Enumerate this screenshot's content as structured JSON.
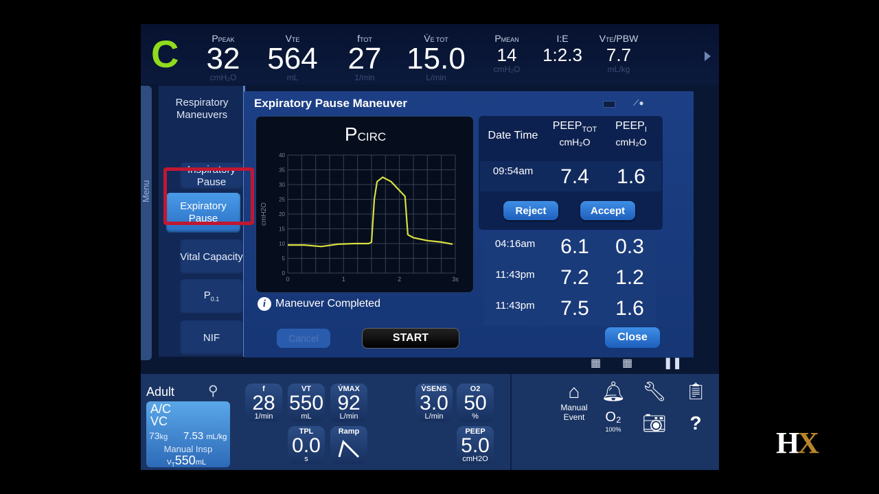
{
  "top": {
    "mode_letter": "C",
    "vitals": [
      {
        "label_main": "P",
        "label_sub": "PEAK",
        "value": "32",
        "unit": "cmH₂O",
        "x": 90,
        "w": 60
      },
      {
        "label_main": "V",
        "label_sub": "TE",
        "value": "564",
        "unit": "mL",
        "x": 180,
        "w": 82
      },
      {
        "label_main": "f",
        "label_sub": "TOT",
        "value": "27",
        "unit": "1/min",
        "x": 298,
        "w": 56
      },
      {
        "label_main": "V̇",
        "label_sub": "E TOT",
        "value": "15.0",
        "unit": "L/min",
        "x": 382,
        "w": 96
      },
      {
        "label_main": "P",
        "label_sub": "MEAN",
        "value": "14",
        "unit": "cmH₂O",
        "x": 506,
        "w": 54
      },
      {
        "label_main": "I:E",
        "label_sub": "",
        "value": "1:2.3",
        "unit": "",
        "x": 584,
        "w": 60
      },
      {
        "label_main": "V",
        "label_sub": "TE",
        "label_extra": "/PBW",
        "value": "7.7",
        "unit": "mL/kg",
        "x": 658,
        "w": 76
      }
    ]
  },
  "menu_label": "Menu",
  "maneuvers": {
    "title": "Respiratory Maneuvers",
    "items": [
      {
        "label": "Inspiratory Pause",
        "selected": false
      },
      {
        "label": "Expiratory Pause",
        "selected": true
      },
      {
        "label": "Vital Capacity",
        "selected": false
      },
      {
        "label": "P0.1",
        "selected": false
      },
      {
        "label": "NIF",
        "selected": false
      }
    ]
  },
  "panel": {
    "title": "Expiratory Pause Maneuver",
    "status": "Maneuver Completed",
    "cancel": "Cancel",
    "start": "START",
    "close": "Close",
    "reject": "Reject",
    "accept": "Accept"
  },
  "graph": {
    "title_main": "P",
    "title_sub": "CIRC",
    "y_label": "cmH2O"
  },
  "chart_data": {
    "type": "line",
    "title": "PCIRC",
    "xlabel": "",
    "ylabel": "cmH2O",
    "xlim": [
      0,
      3
    ],
    "ylim": [
      0,
      40
    ],
    "x_ticks": [
      "0",
      "1",
      "2",
      "3s"
    ],
    "y_ticks": [
      "0",
      "5",
      "10",
      "15",
      "20",
      "25",
      "30",
      "35",
      "40"
    ],
    "grid": true,
    "series": [
      {
        "color": "#d8e040",
        "x": [
          0,
          0.3,
          0.6,
          0.9,
          1.2,
          1.45,
          1.5,
          1.55,
          1.6,
          1.7,
          1.85,
          2.0,
          2.1,
          2.15,
          2.25,
          2.5,
          2.75,
          2.95
        ],
        "y": [
          9.5,
          9.5,
          9.0,
          9.8,
          10.0,
          10.0,
          10.5,
          25,
          31,
          32.5,
          31,
          28,
          26,
          13,
          12,
          11,
          10.5,
          9.8
        ]
      }
    ]
  },
  "table": {
    "headers": {
      "date_time": "Date Time",
      "peep_tot_main": "PEEP",
      "peep_tot_sub": "TOT",
      "peep_tot_unit": "cmH₂O",
      "peep_i_main": "PEEP",
      "peep_i_sub": "I",
      "peep_i_unit": "cmH₂O"
    },
    "current": {
      "time": "09:54am",
      "peep_tot": "7.4",
      "peep_i": "1.6"
    },
    "history": [
      {
        "time": "04:16am",
        "peep_tot": "6.1",
        "peep_i": "0.3"
      },
      {
        "time": "11:43pm",
        "peep_tot": "7.2",
        "peep_i": "1.2"
      },
      {
        "time": "11:43pm",
        "peep_tot": "7.5",
        "peep_i": "1.6"
      }
    ]
  },
  "patient": {
    "type": "Adult",
    "mode_line1": "A/C",
    "mode_line2": "VC",
    "weight": "73",
    "weight_unit": "kg",
    "vt_per_kg": "7.53",
    "vt_per_kg_unit": "mL/kg",
    "manual_insp_label": "Manual Insp",
    "manual_vt": "550",
    "manual_vt_unit": "mL"
  },
  "settings": [
    {
      "label": "f",
      "value": "28",
      "unit": "1/min"
    },
    {
      "label": "VT",
      "value": "550",
      "unit": "mL"
    },
    {
      "label": "V̇MAX",
      "value": "92",
      "unit": "L/min"
    },
    {
      "label": "V̇SENS",
      "value": "3.0",
      "unit": "L/min"
    },
    {
      "label": "O2",
      "value": "50",
      "unit": "%"
    },
    {
      "label": "TPL",
      "value": "0.0",
      "unit": "s"
    },
    {
      "label": "Ramp",
      "value": "",
      "unit": ""
    },
    {
      "label": "PEEP",
      "value": "5.0",
      "unit": "cmH2O"
    }
  ],
  "utilities": {
    "manual_event": "Manual Event",
    "o2_label": "O₂",
    "o2_value": "100%"
  },
  "brand": {
    "h": "H",
    "x": "X"
  },
  "colors": {
    "accent_green": "#8fdc1c",
    "highlight_red": "#c01832",
    "trace_yellow": "#d8e040"
  }
}
